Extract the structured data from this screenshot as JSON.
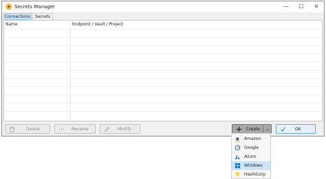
{
  "window": {
    "title": "Secrets Manager",
    "controls": {
      "minimize": "—",
      "maximize": "☐",
      "close": "✕"
    }
  },
  "tabs": [
    {
      "label": "Connections",
      "active": true
    },
    {
      "label": "Secrets",
      "active": false
    }
  ],
  "table": {
    "columns": [
      "Name",
      "Endpoint / Vault / Project"
    ],
    "rows": []
  },
  "buttons": {
    "delete": {
      "label": "Delete",
      "icon": "trash-icon",
      "enabled": false
    },
    "rename": {
      "label": "Rename",
      "icon": "ellipsis-icon",
      "enabled": false
    },
    "modify": {
      "label": "Modify",
      "icon": "pencil-icon",
      "enabled": false
    },
    "create": {
      "label": "Create",
      "icon": "plus-icon",
      "enabled": true
    },
    "ok": {
      "label": "OK",
      "icon": "checkmark-icon",
      "enabled": true
    }
  },
  "create_menu": {
    "items": [
      {
        "label": "Amazon",
        "icon": "amazon-icon",
        "selected": false
      },
      {
        "label": "Google",
        "icon": "google-icon",
        "selected": false
      },
      {
        "label": "Azure",
        "icon": "azure-icon",
        "selected": false
      },
      {
        "label": "Windows",
        "icon": "windows-icon",
        "selected": true
      },
      {
        "label": "HashiCorp",
        "icon": "hashicorp-icon",
        "selected": false
      }
    ]
  },
  "colors": {
    "selection": "#cce4f7",
    "active_tab": "#cfe6ff",
    "ok_border": "#6aa6df",
    "check_green": "#3aa845"
  }
}
